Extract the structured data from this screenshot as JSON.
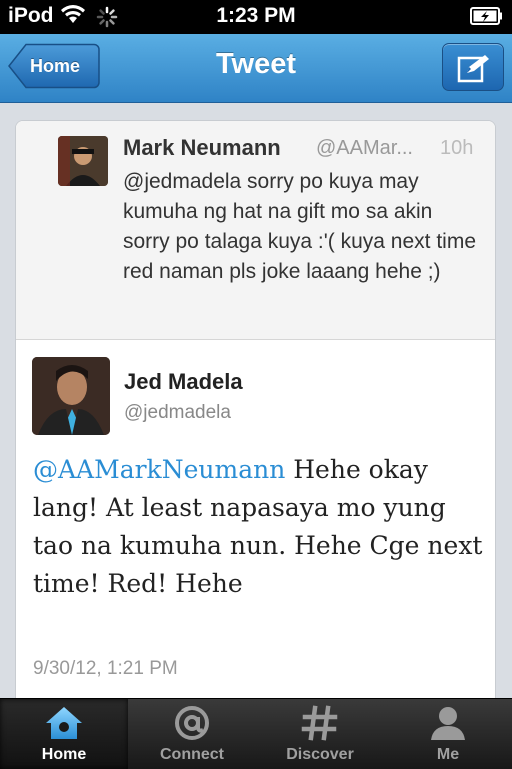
{
  "status_bar": {
    "carrier": "iPod",
    "time": "1:23 PM"
  },
  "nav": {
    "back_label": "Home",
    "title": "Tweet",
    "compose_icon": "compose-icon"
  },
  "reply_tweet": {
    "name": "Mark Neumann",
    "handle": "@AAMar...",
    "time": "10h",
    "text": "@jedmadela sorry po kuya may kumuha  ng hat na gift mo sa akin sorry po talaga kuya :'( kuya next time red naman pls joke laaang hehe ;)"
  },
  "tweet": {
    "name": "Jed Madela",
    "handle": "@jedmadela",
    "mention": "@AAMarkNeumann",
    "body": " Hehe okay lang! At least napasaya mo yung tao na kumuha nun. Hehe Cge next time! Red! Hehe",
    "timestamp": "9/30/12, 1:21 PM",
    "mention_color": "#2a8dd4"
  },
  "tabs": [
    {
      "label": "Home",
      "icon": "home-icon",
      "active": true
    },
    {
      "label": "Connect",
      "icon": "at-icon",
      "active": false
    },
    {
      "label": "Discover",
      "icon": "hash-icon",
      "active": false
    },
    {
      "label": "Me",
      "icon": "person-icon",
      "active": false
    }
  ],
  "colors": {
    "nav_blue": "#3a8fd3",
    "link_blue": "#2a8dd4",
    "active_tab_icon": "#4fb2f0"
  }
}
